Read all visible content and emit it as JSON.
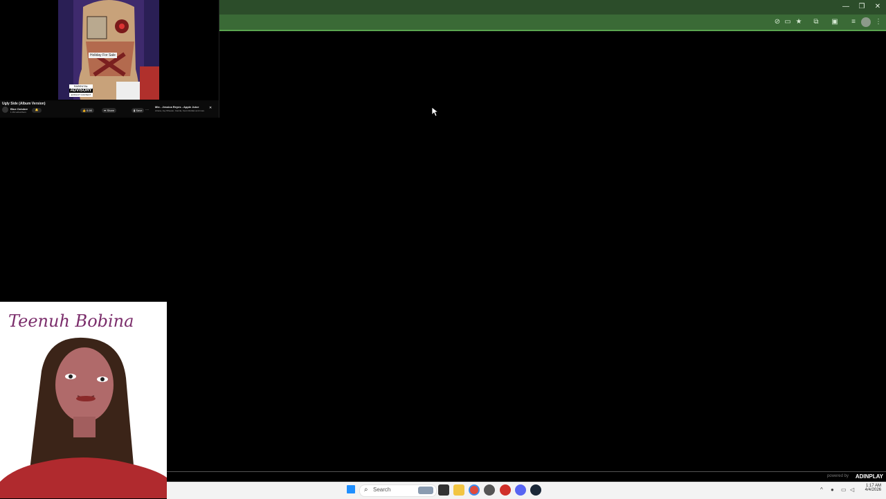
{
  "player": {
    "song_title": "Ugly Side (Album Version)",
    "channel": "Blue October",
    "subscribers": "1.1M subscribers",
    "likes": "6.6K",
    "share": "Share",
    "save": "Save",
    "up_next_title": "Mix - Jessica Reyes - Apple Juice",
    "up_next_sub": "Lihana, Jay Wheeler, Camila, Kevin Roldan and more",
    "sticker_text": "Holiday For Sale",
    "advisory_top": "PARENTAL",
    "advisory_mid": "ADVISORY",
    "advisory_bottom": "EXPLICIT CONTENT"
  },
  "webcam": {
    "name": "Teenuh Bobina"
  },
  "ad": {
    "powered": "powered by",
    "brand": "ADINPLAY"
  },
  "taskbar": {
    "search_placeholder": "Search",
    "time": "1:17 AM",
    "date": "4/4/2026"
  },
  "colors": {
    "browser_title": "#2c4d2a",
    "browser_toolbar": "#3a6a36",
    "accent": "#5aa44f"
  }
}
